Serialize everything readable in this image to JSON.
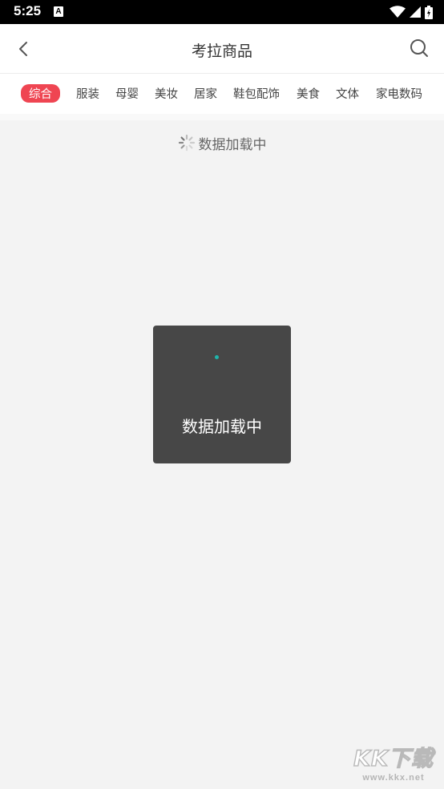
{
  "status_bar": {
    "time": "5:25",
    "notification_icon_letter": "A"
  },
  "nav": {
    "title": "考拉商品",
    "back_icon": "chevron-left-icon",
    "search_icon": "search-icon"
  },
  "tabs": [
    {
      "label": "综合",
      "active": true
    },
    {
      "label": "服装",
      "active": false
    },
    {
      "label": "母婴",
      "active": false
    },
    {
      "label": "美妆",
      "active": false
    },
    {
      "label": "居家",
      "active": false
    },
    {
      "label": "鞋包配饰",
      "active": false
    },
    {
      "label": "美食",
      "active": false
    },
    {
      "label": "文体",
      "active": false
    },
    {
      "label": "家电数码",
      "active": false
    }
  ],
  "loader": {
    "text": "数据加载中"
  },
  "toast": {
    "text": "数据加载中"
  },
  "watermark": {
    "logo": "KK下载",
    "url": "www.kkx.net"
  },
  "colors": {
    "accent": "#ef4552",
    "toast_bg": "#474747",
    "spinner_dot": "#1fb5ac",
    "page_bg": "#f3f3f3"
  }
}
